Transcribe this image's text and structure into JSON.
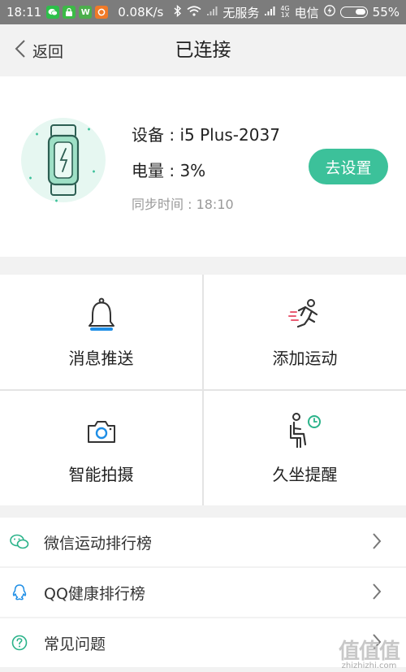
{
  "status_bar": {
    "time": "18:11",
    "speed": "0.08K/s",
    "carrier1": "无服务",
    "net_top": "4G",
    "net_bottom": "1X",
    "carrier2": "电信",
    "battery": "55%",
    "icons": [
      "wechat-icon",
      "lock-app-icon",
      "w-app-icon",
      "orange-app-icon",
      "bluetooth-icon",
      "wifi-icon",
      "signal-icon",
      "charging-icon"
    ]
  },
  "header": {
    "back_label": "返回",
    "title": "已连接"
  },
  "device": {
    "name": "设备 : i5 Plus-2037",
    "battery": "电量 : 3%",
    "sync": "同步时间 : 18:10",
    "settings_button": "去设置"
  },
  "features": [
    {
      "label": "消息推送",
      "icon": "bell-icon"
    },
    {
      "label": "添加运动",
      "icon": "running-icon"
    },
    {
      "label": "智能拍摄",
      "icon": "camera-icon"
    },
    {
      "label": "久坐提醒",
      "icon": "sitting-clock-icon"
    }
  ],
  "list": [
    {
      "label": "微信运动排行榜",
      "icon": "wechat-icon"
    },
    {
      "label": "QQ健康排行榜",
      "icon": "qq-icon"
    },
    {
      "label": "常见问题",
      "icon": "question-icon"
    }
  ],
  "colors": {
    "accent": "#3cc19a",
    "status_bar": "#7c7c7c",
    "icon_blue": "#1e8ee6",
    "icon_green": "#2bb38a"
  },
  "watermark": {
    "logo": "值值值",
    "url": "zhizhizhi.com"
  }
}
